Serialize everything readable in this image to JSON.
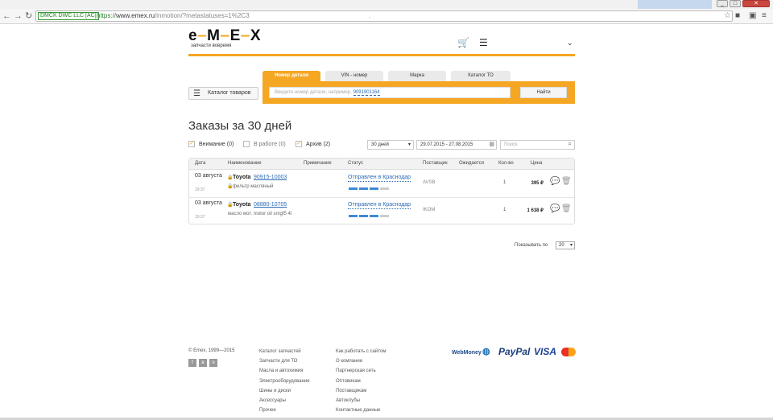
{
  "browser": {
    "security_label": "DMCK DWC LLC [AC]",
    "url_protocol": "https://",
    "url_host": "www.emex.ru",
    "url_path": "/inmotion/?metastatuses=1%2C3",
    "url_extra": ".",
    "back_icon": "back-arrow-icon",
    "forward_icon": "forward-arrow-icon",
    "reload_icon": "reload-icon",
    "bookmark_icon": "star-icon",
    "menu_icon": "menu-icon"
  },
  "header": {
    "logo_text_a": "e",
    "logo_text_b": "M",
    "logo_text_c": "E",
    "logo_text_d": "X",
    "tagline": "запчасти вовремя",
    "accent_color": "#f5a623"
  },
  "search": {
    "tabs": [
      {
        "label": "Номер детали"
      },
      {
        "label": "VIN - номер"
      },
      {
        "label": "Марка"
      },
      {
        "label": "Каталог ТО"
      }
    ],
    "catalog_label": "Каталог товаров",
    "placeholder": "Введите номер детали, например,",
    "example": "9091901164",
    "button_label": "Найти"
  },
  "page": {
    "title": "Заказы за 30 дней"
  },
  "filters": {
    "items": [
      {
        "label": "Внимание (0)",
        "checked": true
      },
      {
        "label": "В работе (0)",
        "checked": false
      },
      {
        "label": "Архив (2)",
        "checked": true
      }
    ],
    "period": "30 дней",
    "date_range": "29.07.2015 - 27.08.2015",
    "search_placeholder": "Поиск"
  },
  "table": {
    "headers": [
      "Дата",
      "Наименование",
      "Примечание",
      "Статус",
      "Поставщик",
      "Ожидается",
      "Кол-во",
      "Цена"
    ],
    "rows": [
      {
        "date": "03 августа",
        "time": "19:37",
        "brand": "Toyota",
        "part": "90915-10003",
        "desc": "фильтр масляный",
        "status": "Отправлен в Краснодар",
        "progress": 0.75,
        "supplier": "AVSB",
        "qty": "1",
        "price": "395 ₽"
      },
      {
        "date": "03 августа",
        "time": "19:37",
        "brand": "Toyota",
        "part": "08880-10705",
        "desc": "масло мот. motor oil sn/gf5 4l",
        "status": "Отправлен в Краснодар",
        "progress": 0.75,
        "supplier": "IKOM",
        "qty": "1",
        "price": "1 638 ₽"
      }
    ]
  },
  "pager": {
    "label": "Показывать по",
    "value": "20"
  },
  "footer": {
    "copyright": "© Emex, 1999—2015",
    "col1": [
      "Каталог запчастей",
      "Запчасти для ТО",
      "Масла и автохимия",
      "Электрооборудование",
      "Шины и диски",
      "Аксессуары",
      "Прочее"
    ],
    "col2": [
      "Как работать с сайтом",
      "О компании",
      "Партнерская сеть",
      "Оптовикам",
      "Поставщикам",
      "Автоклубы",
      "Контактные данные"
    ],
    "payments": {
      "webmoney": "WebMoney",
      "paypal": "PayPal",
      "visa": "VISA"
    }
  }
}
